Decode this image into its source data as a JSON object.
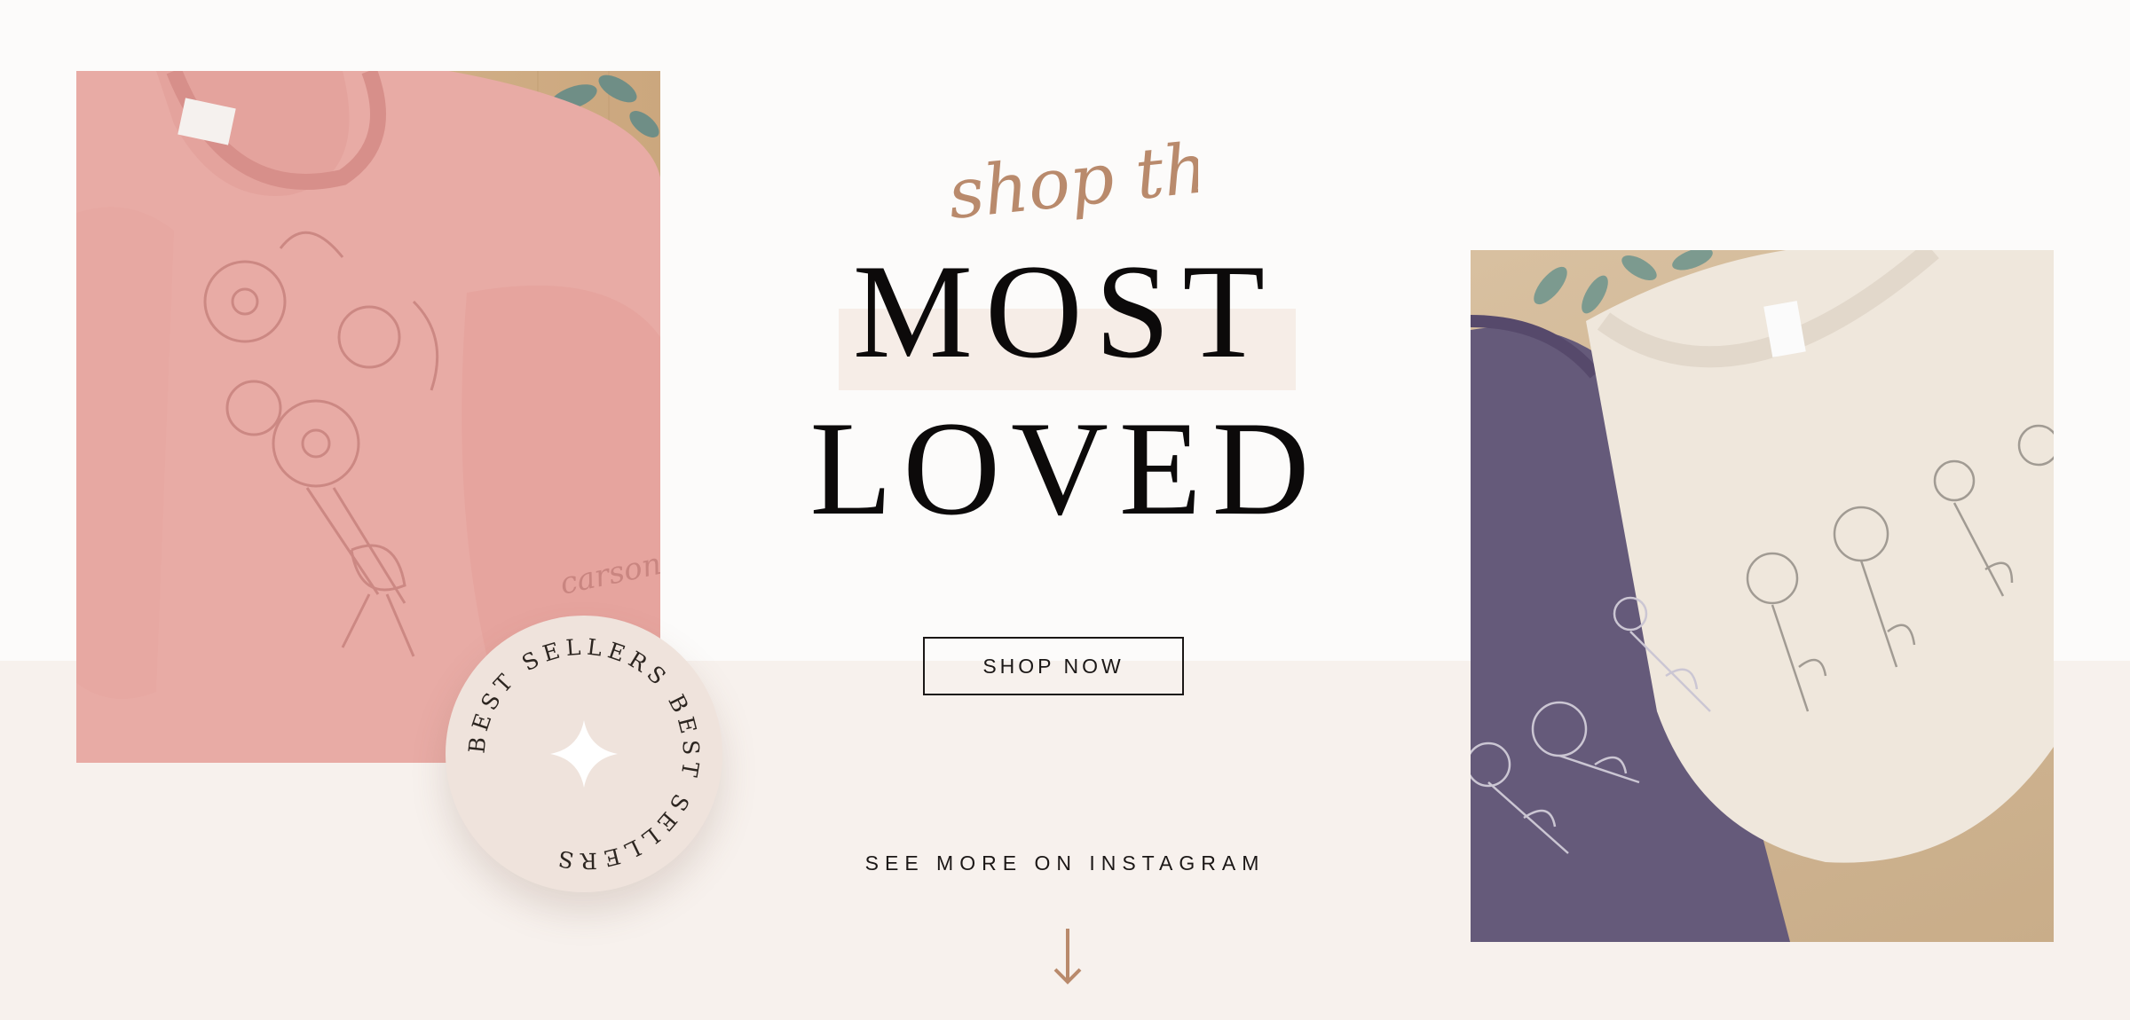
{
  "hero": {
    "script_text": "shop the",
    "headline_line1": "MOST",
    "headline_line2": "LOVED",
    "shop_button_label": "SHOP NOW",
    "instagram_link_label": "SEE MORE ON INSTAGRAM"
  },
  "badge": {
    "ring_text": "BEST SELLERS BEST SELLERS "
  },
  "images": {
    "left": {
      "subject": "pink embroidered bouquet sweatshirt",
      "embroidered_text": "carson"
    },
    "right": {
      "subject": "cream and purple embroidered wildflower sweatshirts"
    }
  },
  "colors": {
    "accent": "#b98a6c",
    "text": "#0c0a0a",
    "band": "#f7f1ed",
    "badge": "#efe3dc"
  },
  "icons": {
    "badge_center": "sparkle-icon",
    "scroll": "arrow-down-icon"
  }
}
